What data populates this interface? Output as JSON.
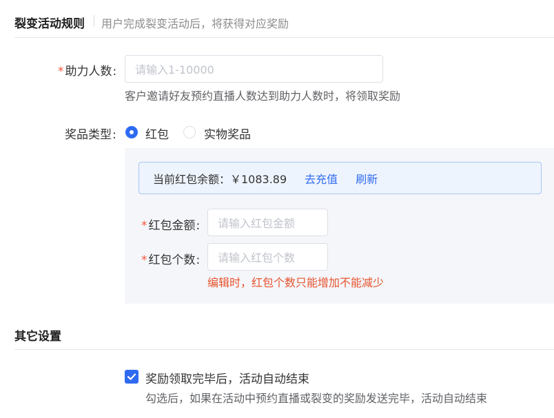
{
  "fission_rules": {
    "title": "裂变活动规则",
    "description": "用户完成裂变活动后，将获得对应奖励"
  },
  "assist_count": {
    "label": "助力人数",
    "placeholder": "请输入1-10000",
    "hint": "客户邀请好友预约直播人数达到助力人数时，将领取奖励"
  },
  "prize_type": {
    "label": "奖品类型",
    "options": [
      {
        "label": "红包",
        "selected": true
      },
      {
        "label": "实物奖品",
        "selected": false
      }
    ]
  },
  "red_packet": {
    "balance_label": "当前红包余额：￥1083.89",
    "recharge_link": "去充值",
    "refresh_link": "刷新",
    "amount_label": "红包金额",
    "amount_placeholder": "请输入红包金额",
    "count_label": "红包个数",
    "count_placeholder": "请输入红包个数",
    "edit_warning": "编辑时，红包个数只能增加不能减少"
  },
  "other_settings": {
    "title": "其它设置",
    "auto_end_label": "奖励领取完毕后，活动自动结束",
    "auto_end_checked": true,
    "auto_end_hint": "勾选后，如果在活动中预约直播或裂变的奖励发送完毕，活动自动结束"
  },
  "colors": {
    "accent": "#2f6bf2",
    "required_star": "#f5563a",
    "warning_text": "#e8532d",
    "panel_bg": "#f4f6fa",
    "balance_bg": "#eef4fd"
  }
}
